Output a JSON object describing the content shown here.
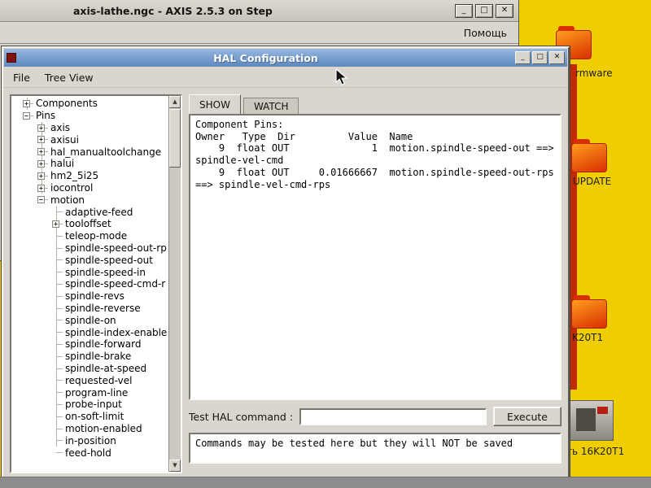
{
  "colors": {
    "desktop": "#EECE00",
    "taskbar": "#8d8d8d",
    "window-bg": "#d9d6cf",
    "titlebar-blue-1": "#96b7e0",
    "titlebar-blue-2": "#5d89c0",
    "folder-orange-1": "#ff9d1e",
    "folder-orange-2": "#d92f00",
    "red-strip": "#c32800",
    "hal-icon-red": "#7e1410"
  },
  "icons": {
    "minimize": "_",
    "maximize": "□",
    "close": "✕",
    "scroll_up": "▲",
    "scroll_down": "▼"
  },
  "desktop": {
    "icons": [
      {
        "name": "firmware",
        "label": "rmware",
        "type": "folder"
      },
      {
        "name": "update",
        "label": "UPDATE",
        "type": "folder"
      },
      {
        "name": "k20t1",
        "label": "K20T1",
        "type": "folder"
      },
      {
        "name": "16k20t1",
        "label": "ть 16K20T1",
        "type": "machine"
      }
    ]
  },
  "axis_window": {
    "title": "axis-lathe.ngc - AXIS 2.5.3 on Step",
    "help_menu": "Помощь"
  },
  "hal_window": {
    "title": "HAL Configuration",
    "menu": {
      "file": "File",
      "tree_view": "Tree View"
    },
    "tabs": {
      "show": "SHOW",
      "watch": "WATCH"
    },
    "output_text": "Component Pins:\nOwner   Type  Dir         Value  Name\n    9  float OUT              1  motion.spindle-speed-out ==>\nspindle-vel-cmd\n    9  float OUT     0.01666667  motion.spindle-speed-out-rps\n==> spindle-vel-cmd-rps",
    "test_command_label": "Test HAL command :",
    "test_command_value": "",
    "execute_label": "Execute",
    "note_text": "Commands may be tested here but they will NOT be saved",
    "tree": {
      "items": [
        {
          "label": "Components",
          "level": 0,
          "glyph": "plus"
        },
        {
          "label": "Pins",
          "level": 0,
          "glyph": "minus"
        },
        {
          "label": "axis",
          "level": 1,
          "glyph": "plus"
        },
        {
          "label": "axisui",
          "level": 1,
          "glyph": "plus"
        },
        {
          "label": "hal_manualtoolchange",
          "level": 1,
          "glyph": "plus"
        },
        {
          "label": "halui",
          "level": 1,
          "glyph": "plus"
        },
        {
          "label": "hm2_5i25",
          "level": 1,
          "glyph": "plus"
        },
        {
          "label": "iocontrol",
          "level": 1,
          "glyph": "plus"
        },
        {
          "label": "motion",
          "level": 1,
          "glyph": "minus"
        },
        {
          "label": "adaptive-feed",
          "level": 2,
          "glyph": "leaf"
        },
        {
          "label": "tooloffset",
          "level": 2,
          "glyph": "plus"
        },
        {
          "label": "teleop-mode",
          "level": 2,
          "glyph": "leaf"
        },
        {
          "label": "spindle-speed-out-rp",
          "level": 2,
          "glyph": "leaf"
        },
        {
          "label": "spindle-speed-out",
          "level": 2,
          "glyph": "leaf"
        },
        {
          "label": "spindle-speed-in",
          "level": 2,
          "glyph": "leaf"
        },
        {
          "label": "spindle-speed-cmd-r",
          "level": 2,
          "glyph": "leaf"
        },
        {
          "label": "spindle-revs",
          "level": 2,
          "glyph": "leaf"
        },
        {
          "label": "spindle-reverse",
          "level": 2,
          "glyph": "leaf"
        },
        {
          "label": "spindle-on",
          "level": 2,
          "glyph": "leaf"
        },
        {
          "label": "spindle-index-enable",
          "level": 2,
          "glyph": "leaf"
        },
        {
          "label": "spindle-forward",
          "level": 2,
          "glyph": "leaf"
        },
        {
          "label": "spindle-brake",
          "level": 2,
          "glyph": "leaf"
        },
        {
          "label": "spindle-at-speed",
          "level": 2,
          "glyph": "leaf"
        },
        {
          "label": "requested-vel",
          "level": 2,
          "glyph": "leaf"
        },
        {
          "label": "program-line",
          "level": 2,
          "glyph": "leaf"
        },
        {
          "label": "probe-input",
          "level": 2,
          "glyph": "leaf"
        },
        {
          "label": "on-soft-limit",
          "level": 2,
          "glyph": "leaf"
        },
        {
          "label": "motion-enabled",
          "level": 2,
          "glyph": "leaf"
        },
        {
          "label": "in-position",
          "level": 2,
          "glyph": "leaf"
        },
        {
          "label": "feed-hold",
          "level": 2,
          "glyph": "leaf"
        }
      ]
    }
  }
}
